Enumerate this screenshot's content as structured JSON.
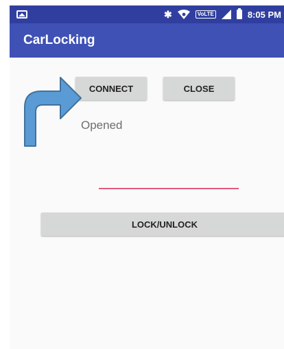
{
  "status_bar": {
    "time": "8:05 PM",
    "network_badge": "VoLTE",
    "icons": [
      "gallery-icon",
      "bluetooth-icon",
      "wifi-icon",
      "signal-icon",
      "battery-icon"
    ]
  },
  "app_bar": {
    "title": "CarLocking"
  },
  "main": {
    "connect_label": "CONNECT",
    "close_label": "CLOSE",
    "status_text": "Opened",
    "input_value": "",
    "lock_unlock_label": "LOCK/UNLOCK"
  },
  "colors": {
    "primary_dark": "#303F9F",
    "primary": "#3F51B5",
    "accent": "#E25A7C",
    "annotation_arrow": "#5B9BD5"
  }
}
